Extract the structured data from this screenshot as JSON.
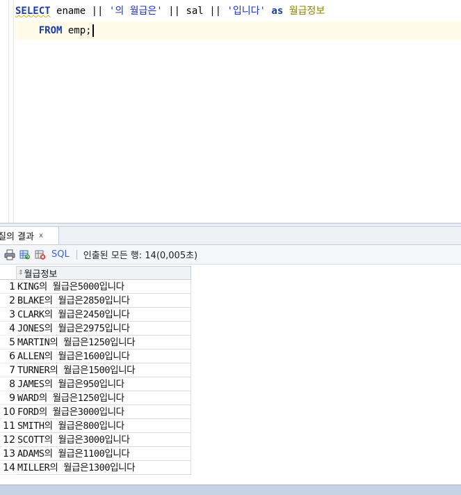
{
  "editor": {
    "line1": {
      "select": "SELECT",
      "col1": "ename",
      "op1": "||",
      "str1": "'의 월급은'",
      "op2": "||",
      "col2": "sal",
      "op3": "||",
      "str2": "'입니다'",
      "as": "as",
      "alias": "월급정보"
    },
    "line2": {
      "from": "FROM",
      "table": "emp;"
    }
  },
  "results_tab": {
    "label": "질의 결과",
    "close": "x"
  },
  "toolbar": {
    "sql_label": "SQL",
    "status": "인출된 모든 행: 14(0,005초)",
    "icons": [
      "print-icon",
      "refresh-icon",
      "cancel-icon"
    ]
  },
  "grid": {
    "column_header": "월급정보",
    "rows": [
      {
        "num": "1",
        "value": "KING의 월급은5000입니다"
      },
      {
        "num": "2",
        "value": "BLAKE의 월급은2850입니다"
      },
      {
        "num": "3",
        "value": "CLARK의 월급은2450입니다"
      },
      {
        "num": "4",
        "value": "JONES의 월급은2975입니다"
      },
      {
        "num": "5",
        "value": "MARTIN의 월급은1250입니다"
      },
      {
        "num": "6",
        "value": "ALLEN의 월급은1600입니다"
      },
      {
        "num": "7",
        "value": "TURNER의 월급은1500입니다"
      },
      {
        "num": "8",
        "value": "JAMES의 월급은950입니다"
      },
      {
        "num": "9",
        "value": "WARD의 월급은1250입니다"
      },
      {
        "num": "10",
        "value": "FORD의 월급은3000입니다"
      },
      {
        "num": "11",
        "value": "SMITH의 월급은800입니다"
      },
      {
        "num": "12",
        "value": "SCOTT의 월급은3000입니다"
      },
      {
        "num": "13",
        "value": "ADAMS의 월급은1100입니다"
      },
      {
        "num": "14",
        "value": "MILLER의 월급은1300입니다"
      }
    ]
  },
  "colors": {
    "keyword": "#1c3e9e",
    "string": "#1d2fcc",
    "alias": "#8a8500",
    "current_line": "#fffbe7",
    "link": "#3a63c6"
  }
}
